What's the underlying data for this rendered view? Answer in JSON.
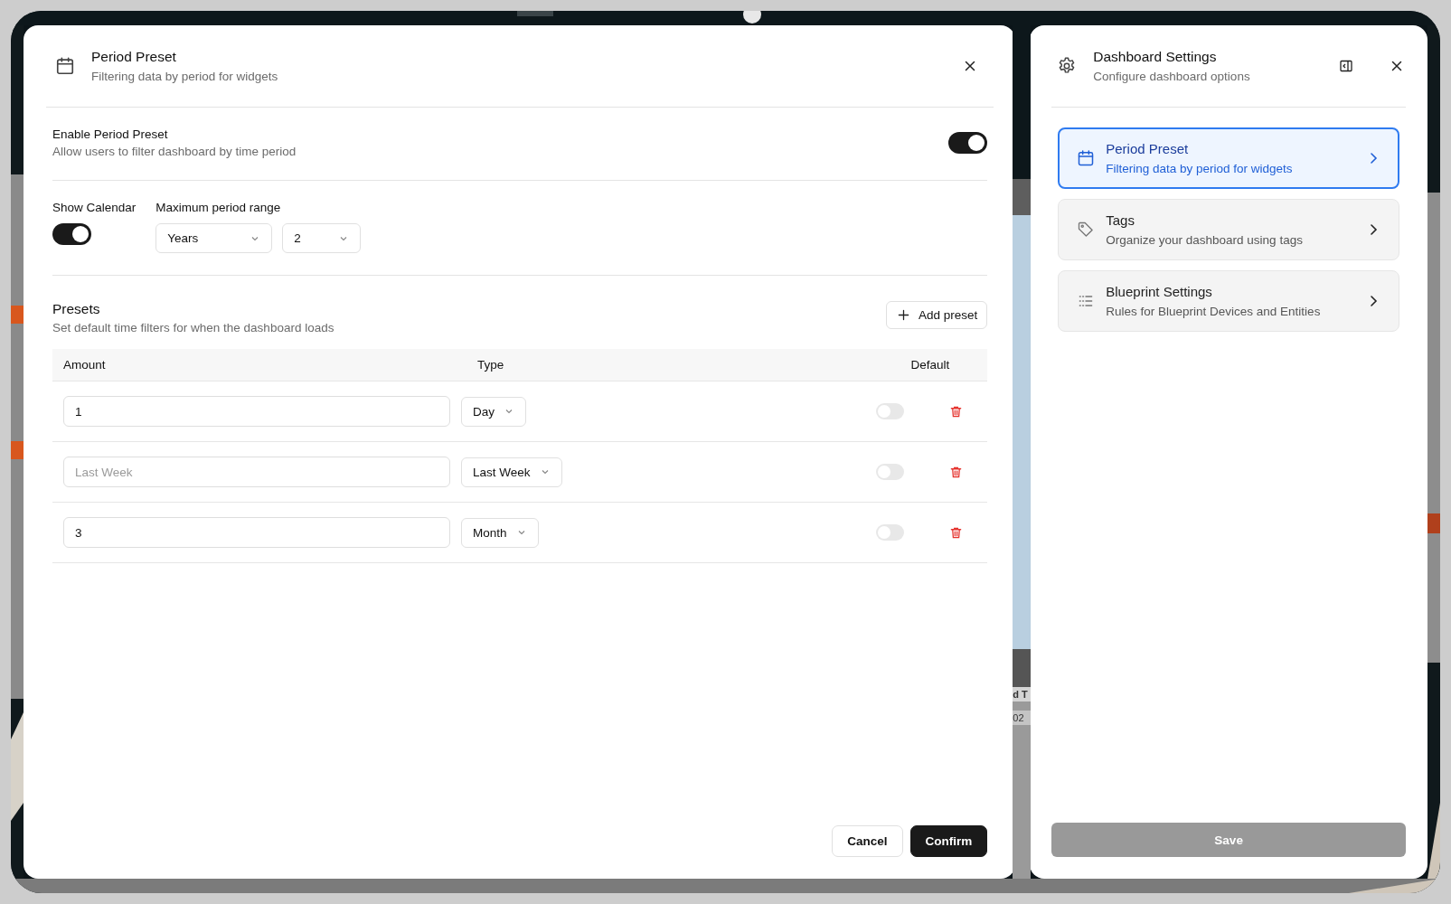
{
  "period_dialog": {
    "title": "Period Preset",
    "subtitle": "Filtering data by period for widgets",
    "enable": {
      "label": "Enable Period Preset",
      "description": "Allow users to filter dashboard by time period",
      "on": true
    },
    "show_calendar": {
      "label": "Show Calendar",
      "on": true
    },
    "max_range": {
      "label": "Maximum period range",
      "unit": "Years",
      "amount": "2"
    },
    "presets": {
      "title": "Presets",
      "description": "Set default time filters for when the dashboard loads",
      "add_button": "Add preset",
      "columns": [
        "Amount",
        "Type",
        "Default"
      ],
      "rows": [
        {
          "amount": "1",
          "type": "Day",
          "default": false
        },
        {
          "placeholder": "Last Week",
          "type": "Last Week",
          "default": false
        },
        {
          "amount": "3",
          "type": "Month",
          "default": false
        }
      ]
    },
    "buttons": [
      "Cancel",
      "Confirm"
    ]
  },
  "background_fragments": [
    "d T",
    "02"
  ],
  "settings_panel": {
    "title": "Dashboard Settings",
    "subtitle": "Configure dashboard options",
    "items": [
      {
        "title": "Period Preset",
        "description": "Filtering data by period for widgets",
        "selected": true
      },
      {
        "title": "Tags",
        "description": "Organize your dashboard using tags",
        "selected": false
      },
      {
        "title": "Blueprint Settings",
        "description": "Rules for Blueprint Devices and Entities",
        "selected": false
      }
    ],
    "save": {
      "label": "Save",
      "disabled": true
    }
  }
}
